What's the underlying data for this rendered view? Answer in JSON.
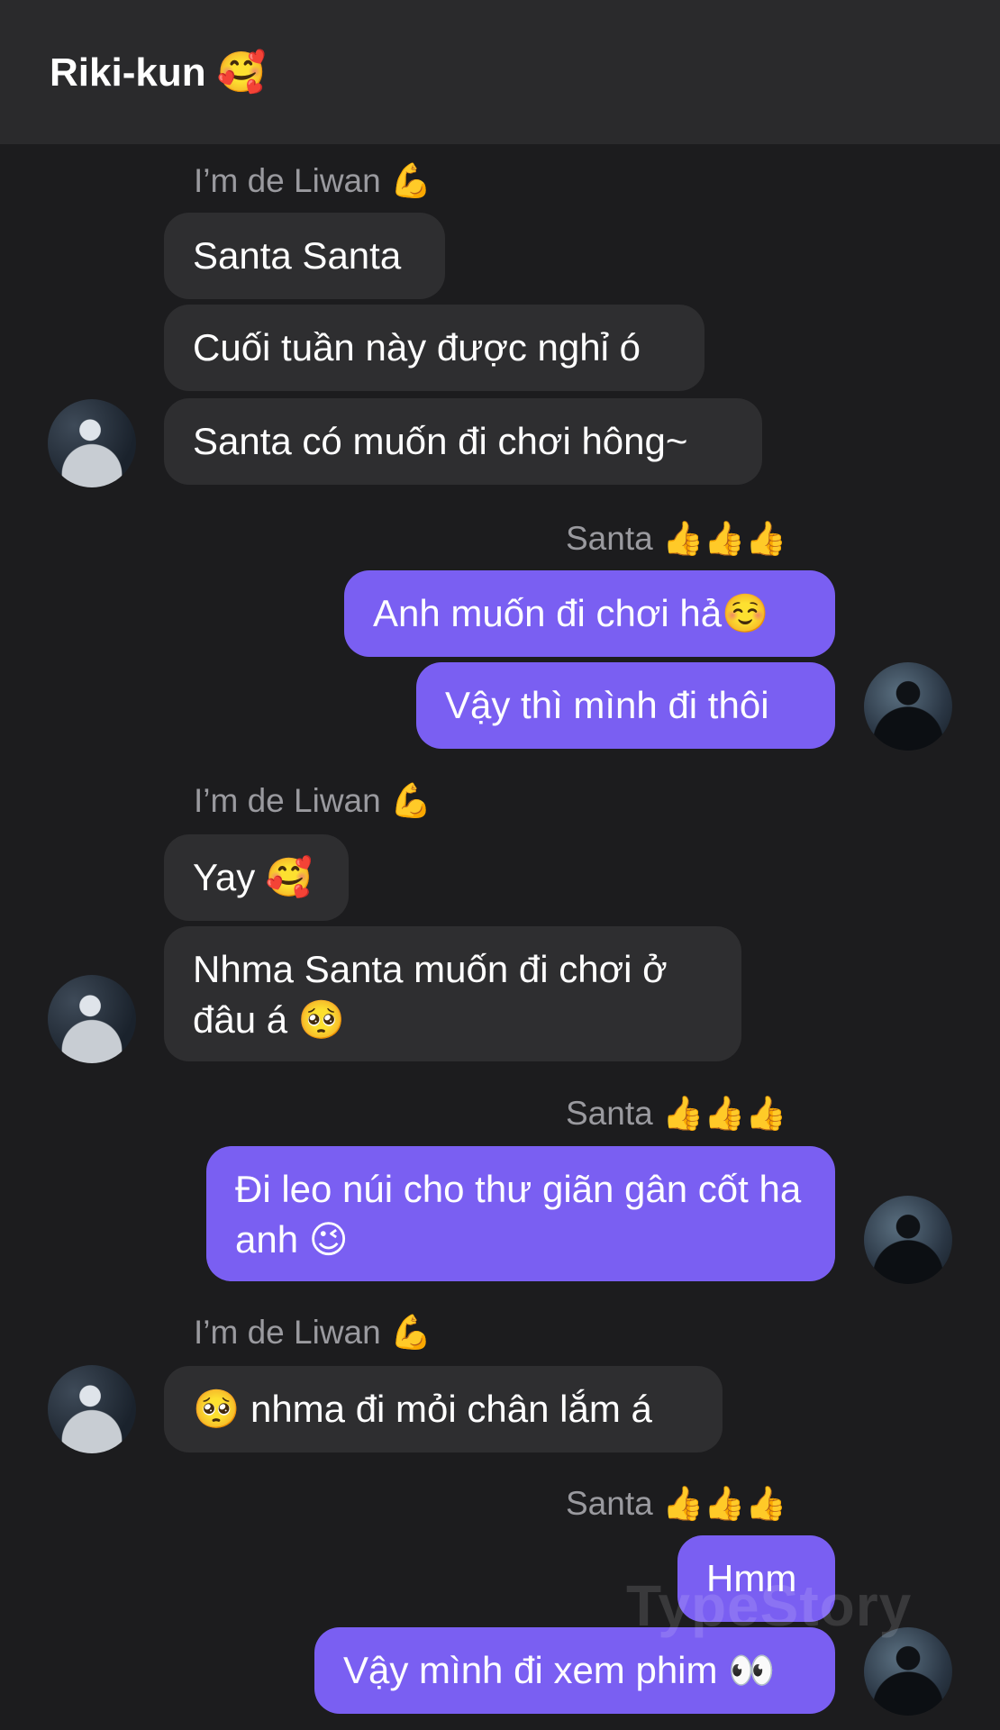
{
  "header": {
    "title": "Riki-kun 🥰"
  },
  "groups": [
    {
      "sender": "I’m de Liwan 💪",
      "messages": [
        "Santa Santa",
        "Cuối tuần này được nghỉ ó",
        "Santa có muốn đi chơi hông~"
      ]
    },
    {
      "sender": "Santa 👍👍👍",
      "messages": [
        "Anh muốn đi chơi hả☺️",
        "Vậy thì mình đi thôi"
      ]
    },
    {
      "sender": "I’m de Liwan 💪",
      "messages": [
        "Yay 🥰",
        "Nhma Santa muốn đi chơi ở đâu á 🥺"
      ]
    },
    {
      "sender": "Santa 👍👍👍",
      "messages": [
        "Đi leo núi cho thư giãn gân cốt ha anh 😉"
      ]
    },
    {
      "sender": "I’m de Liwan 💪",
      "messages": [
        "🥺 nhma đi mỏi chân lắm á"
      ]
    },
    {
      "sender": "Santa 👍👍👍",
      "messages": [
        "Hmm",
        "Vậy mình đi xem phim 👀"
      ]
    }
  ],
  "watermark": "TypeStory"
}
